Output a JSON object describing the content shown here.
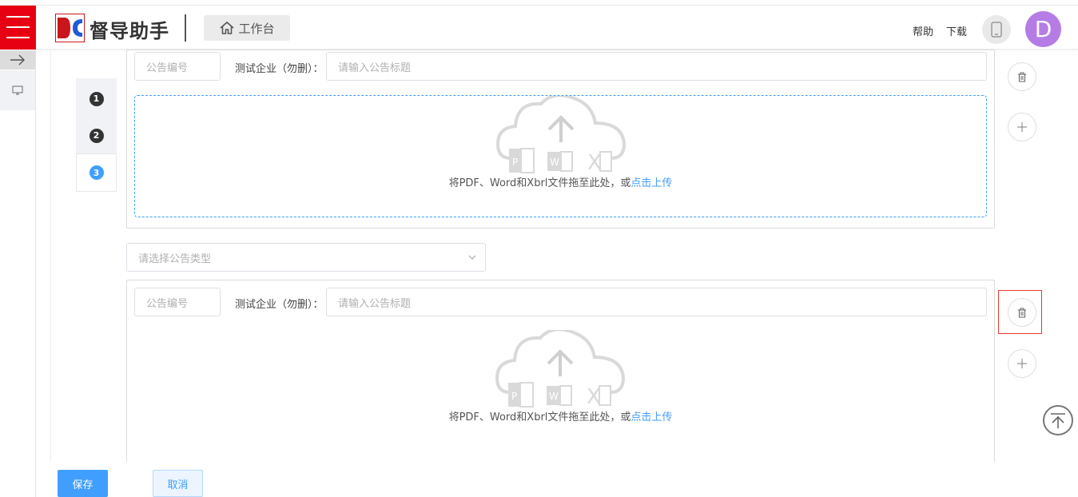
{
  "header": {
    "brand": "督导助手",
    "workbench_label": "工作台",
    "help_label": "帮助",
    "download_label": "下载",
    "avatar_letter": "D",
    "avatar_color": "#b67ce6",
    "accent_red": "#e60012"
  },
  "steps": [
    {
      "number": "1",
      "state": "done"
    },
    {
      "number": "2",
      "state": "done"
    },
    {
      "number": "3",
      "state": "active"
    }
  ],
  "announcements": [
    {
      "number_placeholder": "公告编号",
      "company_label": "测试企业（勿删）：",
      "title_placeholder": "请输入公告标题",
      "drop_text": "将PDF、Word和Xbrl文件拖至此处，或",
      "drop_link": "点击上传"
    },
    {
      "type_placeholder": "请选择公告类型",
      "number_placeholder": "公告编号",
      "company_label": "测试企业（勿删）：",
      "title_placeholder": "请输入公告标题",
      "drop_text": "将PDF、Word和Xbrl文件拖至此处，或",
      "drop_link": "点击上传"
    }
  ],
  "actions": {
    "save_label": "保存",
    "cancel_label": "取消"
  },
  "colors": {
    "primary": "#409eff",
    "highlight_border": "#e53935"
  }
}
